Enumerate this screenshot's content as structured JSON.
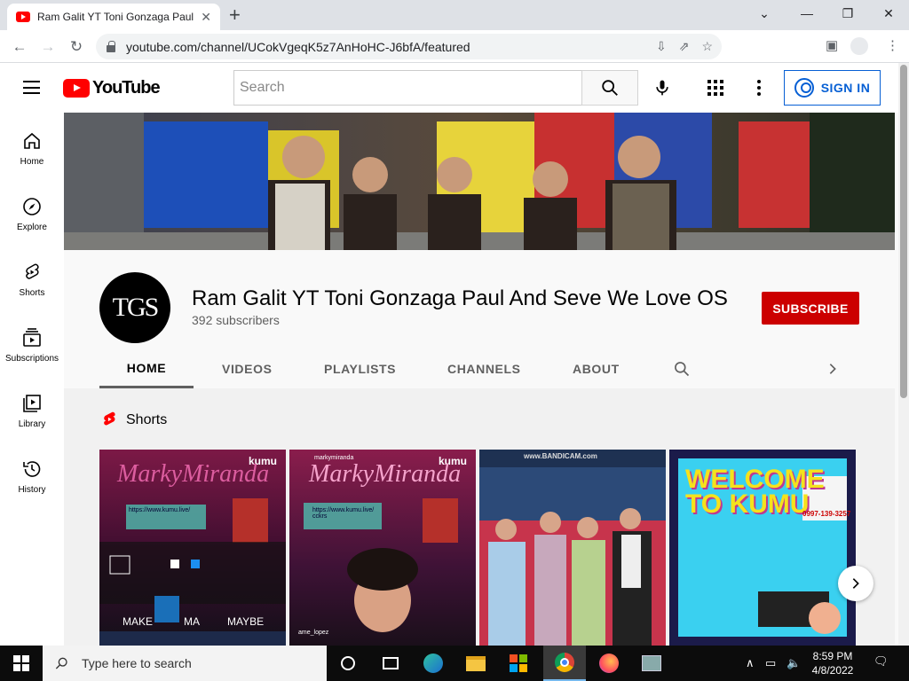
{
  "browser": {
    "tab_title": "Ram Galit YT Toni Gonzaga Paul And Seve We Love OS - YouTube",
    "tab_title_short": "Ram Galit YT Toni Gonzaga Paul",
    "url": "youtube.com/channel/UCokVgeqK5z7AnHoHC-J6bfA/featured"
  },
  "header": {
    "logo_text": "YouTube",
    "search_placeholder": "Search",
    "sign_in_label": "SIGN IN"
  },
  "guide": {
    "items": [
      {
        "label": "Home",
        "icon": "home-icon"
      },
      {
        "label": "Explore",
        "icon": "compass-icon"
      },
      {
        "label": "Shorts",
        "icon": "shorts-icon"
      },
      {
        "label": "Subscriptions",
        "icon": "subscriptions-icon"
      },
      {
        "label": "Library",
        "icon": "library-icon"
      },
      {
        "label": "History",
        "icon": "history-icon"
      }
    ]
  },
  "channel": {
    "name": "Ram Galit YT Toni Gonzaga Paul And Seve We Love OS",
    "subscribers": "392 subscribers",
    "avatar_text": "TGS",
    "subscribe_label": "SUBSCRIBE",
    "tabs": [
      "HOME",
      "VIDEOS",
      "PLAYLISTS",
      "CHANNELS",
      "ABOUT"
    ],
    "active_tab": "HOME"
  },
  "shorts": {
    "title": "Shorts",
    "thumbs": [
      {
        "caption": "kumu",
        "overlay": "MarkyMiranda",
        "link": "https://www.kumu.live/",
        "bottom_left": "MAKE",
        "bottom_mid": "MA",
        "bottom_right": "MAYBE"
      },
      {
        "caption": "kumu",
        "overlay": "MarkyMiranda",
        "user": "markymiranda",
        "link": "https://www.kumu.live/ cckrs",
        "comment_user": "ame_lopez"
      },
      {
        "caption": "www.BANDICAM.com"
      },
      {
        "caption": "WELCOME TO KUMU",
        "phone": "0997-139-3257"
      }
    ]
  },
  "taskbar": {
    "search_placeholder": "Type here to search",
    "time": "8:59 PM",
    "date": "4/8/2022"
  },
  "colors": {
    "brand_red": "#ff0000",
    "subscribe_red": "#cc0000",
    "link_blue": "#065fd4"
  }
}
